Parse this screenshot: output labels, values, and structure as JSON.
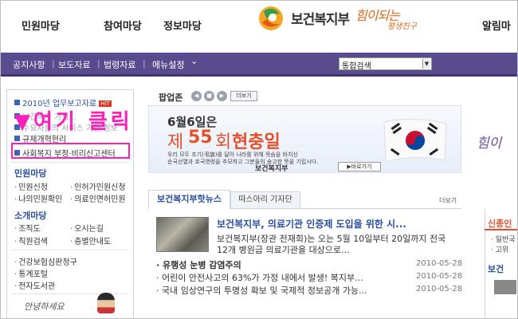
{
  "header": {
    "nav_items": [
      "민원마당",
      "참여마당",
      "정보마당"
    ],
    "logo_text": "보건복지부",
    "slogan": "힘이되는",
    "slogan_sub": "평생친구",
    "right_menu": "알림마"
  },
  "subnav": {
    "items": [
      "공지사항",
      "보도자료",
      "법령자료",
      "메뉴설정"
    ],
    "dropdown_indicator": "⌄",
    "search_placeholder": "통합검색"
  },
  "sidebar": {
    "report_link": "2010년 업무보고자료",
    "report_badge": "HIT",
    "obscured_line_1": "보건복지 가정...",
    "obscured_line_2": "수요자원의 서비스 기원 정보",
    "regulation_link": "규제개혁현리",
    "fraud_center": "사회복지 부정·비리신고센터",
    "civil_head": "민원마당",
    "civil_items": [
      "민원신청",
      "인허가민원신청",
      "나의민원확인",
      "의료인면허민원"
    ],
    "intro_head": "소개마당",
    "intro_items": [
      "조직도",
      "오시는길",
      "직원검색",
      "층별안내도"
    ],
    "bottom_items": [
      "건강보험심판청구",
      "통계포털",
      "전자도서관"
    ],
    "greeting": "안녕하세요"
  },
  "overlay": {
    "text": "▼여기 클릭",
    "color": "#ff1fb8"
  },
  "popup": {
    "label": "팝업존",
    "prev": "◀",
    "pause": "■",
    "next": "▶",
    "more": "더보기",
    "banner_date": "6월6일은",
    "banner_title": [
      "제",
      "55",
      "회",
      "현충일"
    ],
    "banner_lines": [
      "우리 모두 조기(弔旗)를 달아 나라를 위해 목숨을 바치신",
      "순국선열과 호국영령을 추모하고 그분들의 숭고한 뜻을 기립시다."
    ],
    "banner_org": "보건복지부",
    "banner_back": "▶바로가기",
    "flag_icon": "korean-flag-icon"
  },
  "right_peek": "힘이",
  "news": {
    "tab_active": "보건복지부핫뉴스",
    "tab_inactive": "따스아리 기자단",
    "more": "더보기",
    "headline": "보건복지부, 의료기관 인증제 도입을 위한 시...",
    "summary_1": "보건복지부(장관 전재희)는 오는 5월 10일부터 20일까지 전국",
    "summary_2": "12개 병원급 의료기관을 대상으로...",
    "list": [
      {
        "title": "유행성 눈병 감염주의",
        "date": "2010-05-28",
        "bold": true
      },
      {
        "title": "어린이 안전사고의 63%가 가정 내에서 발생! 복지부...",
        "date": "2010-05-28",
        "bold": false
      },
      {
        "title": "국내 임상연구의 투명성 확보 및 국제적 정보공개 가능...",
        "date": "2010-05-28",
        "bold": false
      }
    ]
  },
  "right_col": {
    "head": "신종인",
    "items": [
      "· 일반국",
      "· 고위"
    ],
    "head2": "보건"
  }
}
